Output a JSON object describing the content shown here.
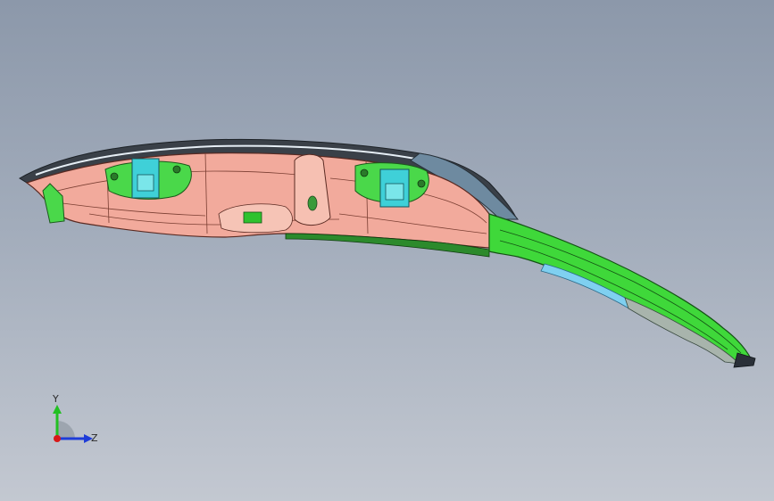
{
  "viewport": {
    "background_top": "#8c98aa",
    "background_bottom": "#c3c8d1",
    "description_colors": {
      "main_panel": "#f2aa9c",
      "tail_strip": "#3fd83a",
      "hinge_bracket": "#4ad84a",
      "clip": "#3fd0d8",
      "trim_edge": "#e6eef5"
    }
  },
  "model": {
    "parts": [
      "main-panel",
      "left-hinge-bracket",
      "right-hinge-bracket",
      "center-channel",
      "tail-strip",
      "edge-trim"
    ]
  },
  "triad": {
    "y_label": "Y",
    "z_label": "Z",
    "x_color": "#d81818",
    "y_color": "#22c022",
    "z_color": "#1e3cd8"
  }
}
